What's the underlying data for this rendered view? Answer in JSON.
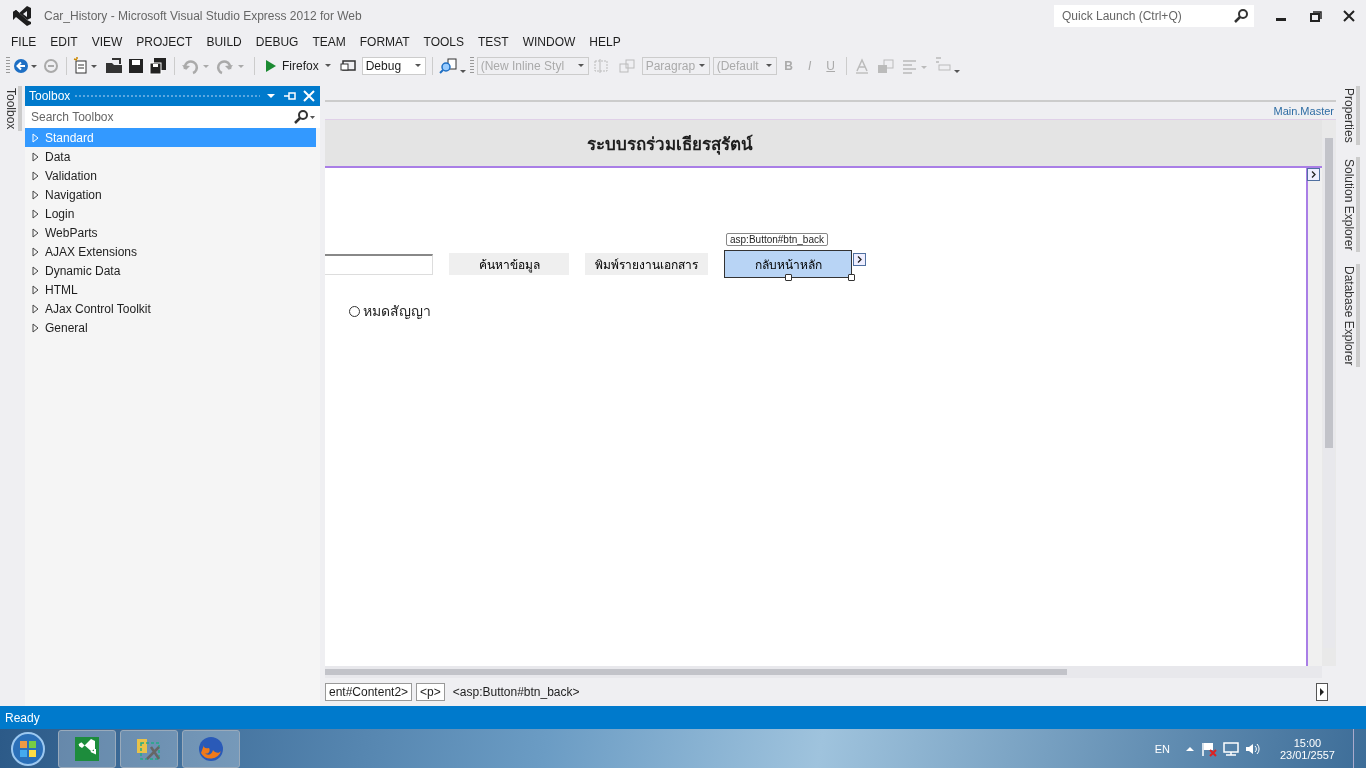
{
  "window": {
    "title": "Car_History - Microsoft Visual Studio Express 2012 for Web"
  },
  "quick_launch": {
    "placeholder": "Quick Launch (Ctrl+Q)"
  },
  "menu": [
    "FILE",
    "EDIT",
    "VIEW",
    "PROJECT",
    "BUILD",
    "DEBUG",
    "TEAM",
    "FORMAT",
    "TOOLS",
    "TEST",
    "WINDOW",
    "HELP"
  ],
  "toolbar": {
    "run_label": "Firefox",
    "combos": [
      {
        "value": "Debug",
        "disabled": false
      },
      {
        "value": "(New Inline Styl",
        "disabled": true
      },
      {
        "value": "Paragrap",
        "disabled": true
      },
      {
        "value": "(Default",
        "disabled": true
      }
    ],
    "format_buttons": [
      {
        "label": "B",
        "disabled": true
      },
      {
        "label": "I",
        "disabled": true
      },
      {
        "label": "U",
        "disabled": true
      }
    ]
  },
  "left_side_tabs": [
    "Toolbox"
  ],
  "toolbox": {
    "title": "Toolbox",
    "search": {
      "placeholder": "Search Toolbox"
    },
    "groups": [
      {
        "label": "Standard",
        "selected": true,
        "expanded": false
      },
      {
        "label": "Data",
        "selected": false,
        "expanded": false
      },
      {
        "label": "Validation",
        "selected": false,
        "expanded": false
      },
      {
        "label": "Navigation",
        "selected": false,
        "expanded": false
      },
      {
        "label": "Login",
        "selected": false,
        "expanded": false
      },
      {
        "label": "WebParts",
        "selected": false,
        "expanded": false
      },
      {
        "label": "AJAX Extensions",
        "selected": false,
        "expanded": false
      },
      {
        "label": "Dynamic Data",
        "selected": false,
        "expanded": false
      },
      {
        "label": "HTML",
        "selected": false,
        "expanded": false
      },
      {
        "label": "AJax Control Toolkit",
        "selected": false,
        "expanded": false
      },
      {
        "label": "General",
        "selected": false,
        "expanded": false
      }
    ]
  },
  "designer": {
    "master_link": "Main.Master",
    "page_title": "ระบบรถร่วมเธียรสุรัตน์",
    "buttons": [
      {
        "label": "ค้นหาข้อมูล",
        "selected": false
      },
      {
        "label": "พิมพ์รายงานเอกสาร",
        "selected": false
      },
      {
        "label": "กลับหน้าหลัก",
        "selected": true,
        "tag": "asp:Button#btn_back"
      }
    ],
    "radios": [
      {
        "label": "หมดสัญญา",
        "selected": false
      }
    ]
  },
  "breadcrumb": [
    "ent#Content2>",
    "<p>",
    "<asp:Button#btn_back>"
  ],
  "right_side_tabs": [
    "Properties",
    "Solution Explorer",
    "Database Explorer"
  ],
  "status_bar": {
    "text": "Ready"
  },
  "taskbar": {
    "apps": [
      {
        "kind": "visual-studio"
      },
      {
        "kind": "tools"
      },
      {
        "kind": "browser"
      }
    ],
    "language": "EN",
    "time": "15:00",
    "date": "23/01/2557"
  }
}
